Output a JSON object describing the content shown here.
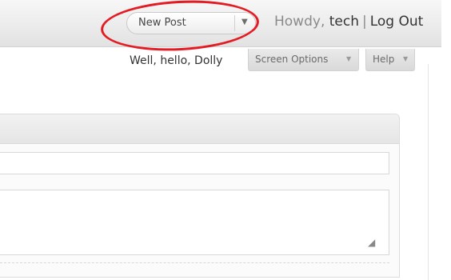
{
  "favorite_actions": {
    "selected": "New Post"
  },
  "header": {
    "greeting": "Howdy,",
    "username": "tech",
    "separator": "|",
    "logout": "Log Out"
  },
  "hello_dolly": "Well, hello, Dolly",
  "tabs": {
    "screen_options": "Screen Options",
    "help": "Help"
  },
  "icons": {
    "dropdown": "chevron-down-icon",
    "tab_arrow": "triangle-down-icon",
    "resize": "resize-grip-icon"
  },
  "colors": {
    "highlight_circle": "#e31b23",
    "header_bg": "#e2e2e2"
  }
}
